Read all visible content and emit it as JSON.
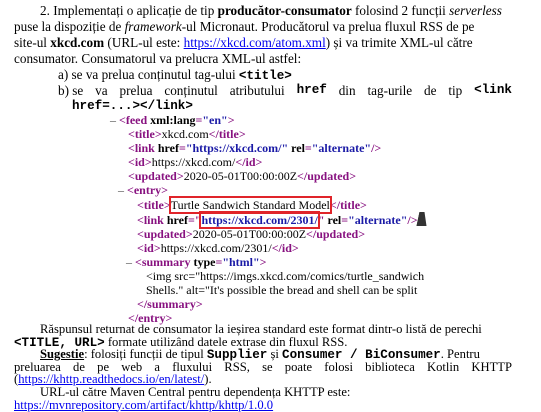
{
  "para2": {
    "l1_a": "2. Implementați o aplicație de tip ",
    "l1_b": "producător-consumator",
    "l1_c": " folosind 2 funcții ",
    "l1_d": "serverless",
    "l2_a": "puse la dispoziție de ",
    "l2_b": "framework",
    "l2_c": "-ul Micronaut. Producătorul va prelua fluxul RSS de pe",
    "l3_a": "site-ul ",
    "l3_b": "xkcd.com",
    "l3_c": " (URL-ul este: ",
    "l3_link": "https://xkcd.com/atom.xml",
    "l3_d": ") și va trimite XML-ul către",
    "l4": "consumator. Consumatorul va prelucra XML-ul astfel:",
    "a_text": "a) se va prelua conținutul tag-ului ",
    "a_code": "<title>",
    "b1_a": "b) se",
    "b1_b": "va",
    "b1_c": "prelua",
    "b1_d": "conținutul",
    "b1_e": "atributului",
    "b1_f": "href",
    "b1_g": "din",
    "b1_h": "tag-urile",
    "b1_i": "de",
    "b1_j": "tip",
    "b1_k": "<link",
    "b2_code": "href=...></link>"
  },
  "xml": {
    "feed_open": "feed",
    "feed_attr_name": "xml:lang",
    "feed_attr_val": "\"en\"",
    "title1": "xkcd.com",
    "link1_href": "\"https://xkcd.com/\"",
    "rel_name": "rel",
    "rel_val": "\"alternate\"",
    "id1": "https://xkcd.com/",
    "updated1": "2020-05-01T00:00:00Z",
    "entry": "entry",
    "title2": "Turtle Sandwich Standard Model",
    "link2_href": "https://xkcd.com/2301/",
    "updated2": "2020-05-01T00:00:00Z",
    "id2": "https://xkcd.com/2301/",
    "summary_type_val": "\"html\"",
    "img_line": "<img src=\"https://imgs.xkcd.com/comics/turtle_sandwich",
    "shells_line": "Shells.\" alt=\"It's possible the bread and shell can be split",
    "toggle": "–"
  },
  "after": {
    "p1_l1": "Răspunsul returnat de consumator la ieșirea standard este format dintr-o listă de perechi",
    "p1_l2_code": "<TITLE, URL>",
    "p1_l2_text": " formate utilizând datele extrase din fluxul RSS.",
    "sug_label": "Sugestie",
    "sug_a": ": folosiți funcții de tipul ",
    "sug_code1": "Supplier",
    "sug_b": " și ",
    "sug_code2": "Consumer / BiConsumer",
    "sug_c": ". Pentru",
    "sug_l2": "preluarea de pe web a fluxului RSS, se poate folosi biblioteca Kotlin KHTTP",
    "sug_l3_open": "(",
    "sug_l3_link": "https://khttp.readthedocs.io/en/latest/",
    "sug_l3_close": ").",
    "maven_l1": "URL-ul către Maven Central pentru dependența KHTTP este:",
    "maven_link": "https://mvnrepository.com/artifact/khttp/khttp/1.0.0"
  }
}
